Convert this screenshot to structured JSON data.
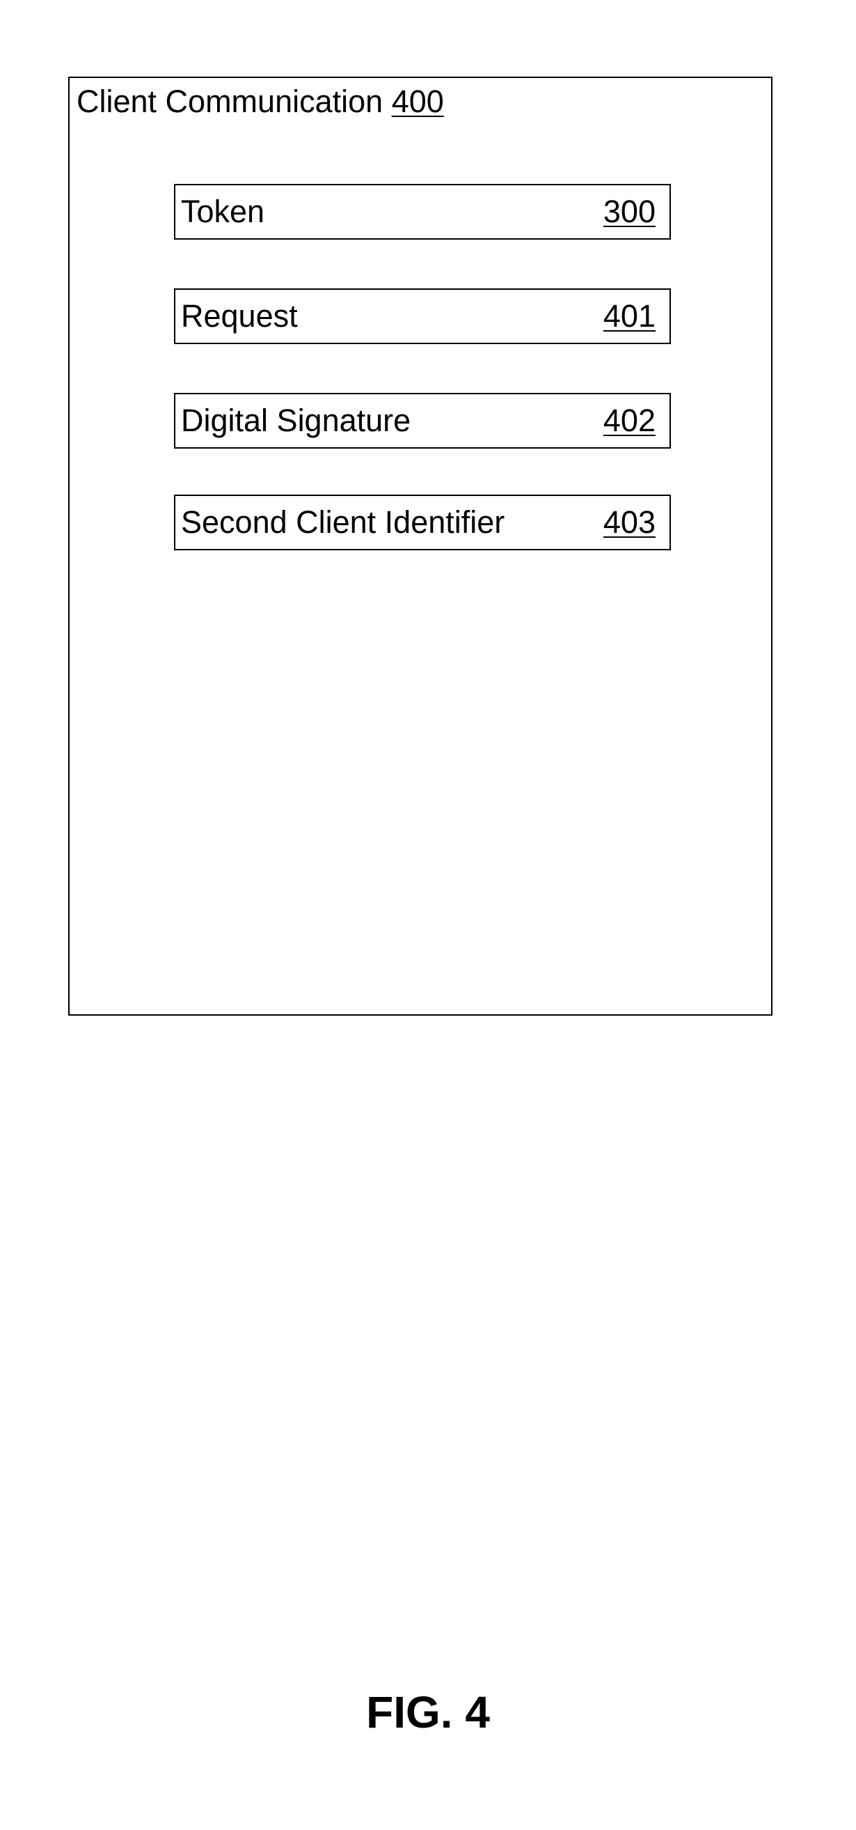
{
  "diagram": {
    "title": {
      "label": "Client Communication",
      "ref": "400"
    },
    "fields": [
      {
        "label": "Token",
        "ref": "300"
      },
      {
        "label": "Request",
        "ref": "401"
      },
      {
        "label": "Digital Signature",
        "ref": "402"
      },
      {
        "label": "Second Client Identifier",
        "ref": "403"
      }
    ]
  },
  "figure": {
    "label": "FIG. 4"
  }
}
